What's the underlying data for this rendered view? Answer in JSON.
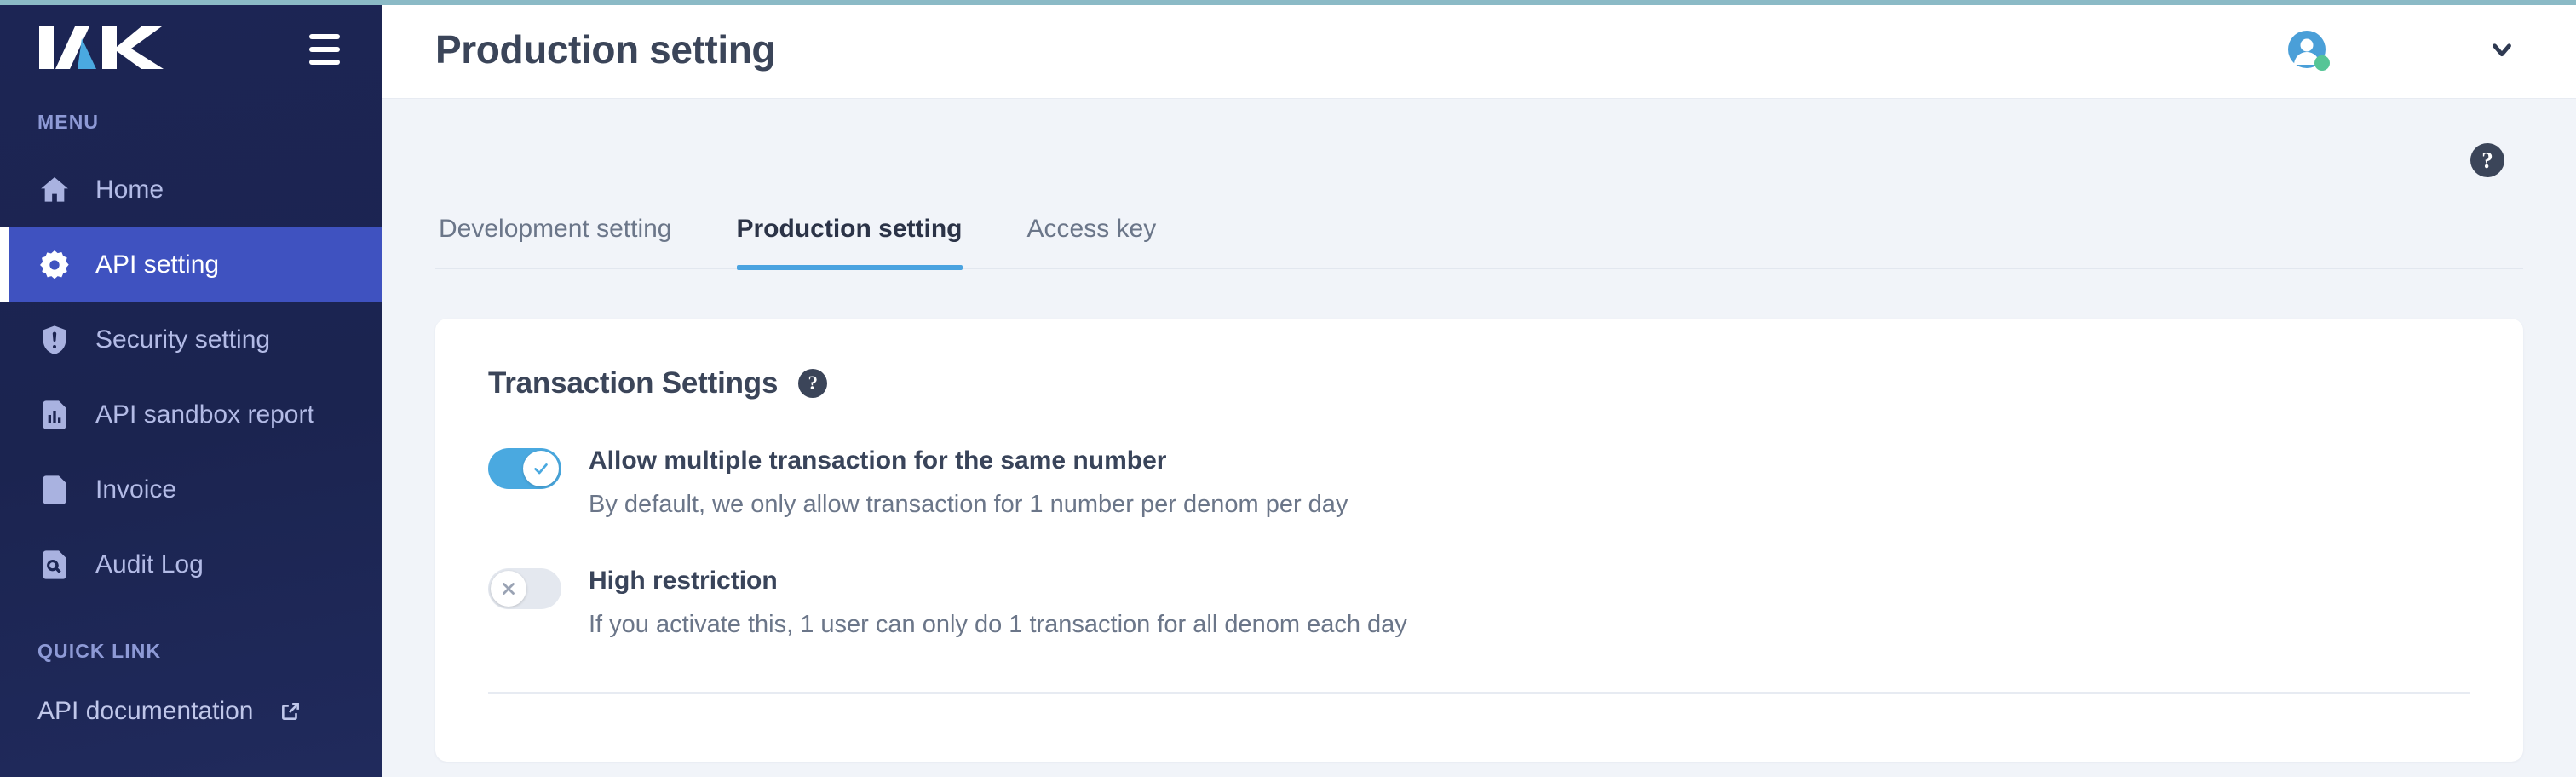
{
  "brand": {
    "logo_text": "IAK",
    "accent_color": "#4aa9e0",
    "sidebar_color": "#1c2554"
  },
  "sidebar": {
    "menu_label": "MENU",
    "items": [
      {
        "label": "Home",
        "icon": "home-icon",
        "active": false
      },
      {
        "label": "API setting",
        "icon": "gear-icon",
        "active": true
      },
      {
        "label": "Security setting",
        "icon": "shield-alert-icon",
        "active": false
      },
      {
        "label": "API sandbox report",
        "icon": "report-chart-icon",
        "active": false
      },
      {
        "label": "Invoice",
        "icon": "invoice-document-icon",
        "active": false
      },
      {
        "label": "Audit Log",
        "icon": "audit-log-icon",
        "active": false
      }
    ],
    "quick_link_label": "QUICK LINK",
    "quick_links": [
      {
        "label": "API documentation",
        "icon": "external-link-icon"
      }
    ],
    "hamburger_icon": "hamburger-menu-icon"
  },
  "header": {
    "title": "Production setting",
    "avatar_icon": "user-avatar-icon",
    "status": "online",
    "status_color": "#56c596",
    "chevron_icon": "chevron-down-icon"
  },
  "content": {
    "help_icon_label": "?",
    "tabs": [
      {
        "label": "Development setting",
        "active": false
      },
      {
        "label": "Production setting",
        "active": true
      },
      {
        "label": "Access key",
        "active": false
      }
    ],
    "card": {
      "title": "Transaction Settings",
      "help_icon_label": "?",
      "settings": [
        {
          "title": "Allow multiple transaction for the same number",
          "description": "By default, we only allow transaction for 1 number per denom per day",
          "enabled": true,
          "toggle_state": "on"
        },
        {
          "title": "High restriction",
          "description": "If you activate this, 1 user can only do 1 transaction for all denom each day",
          "enabled": false,
          "toggle_state": "off"
        }
      ]
    }
  }
}
